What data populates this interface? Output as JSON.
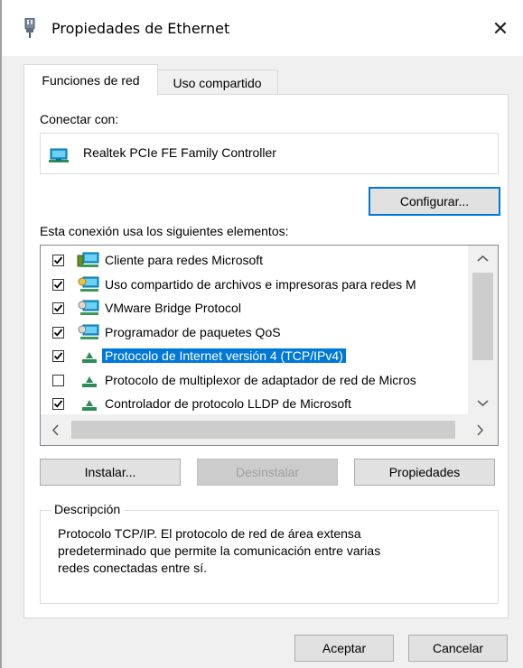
{
  "window": {
    "title": "Propiedades de Ethernet",
    "close_glyph": "✕"
  },
  "tabs": [
    {
      "label": "Funciones de red",
      "active": true
    },
    {
      "label": "Uso compartido",
      "active": false
    }
  ],
  "connect": {
    "label": "Conectar con:",
    "adapter_name": "Realtek PCIe FE Family Controller",
    "configure_label": "Configurar..."
  },
  "elements": {
    "label": "Esta conexión usa los siguientes elementos:",
    "items": [
      {
        "label": "Cliente para redes Microsoft",
        "checked": true,
        "icon": "network-client-icon",
        "selected": false
      },
      {
        "label": "Uso compartido de archivos e impresoras para redes M",
        "checked": true,
        "icon": "file-printer-sharing-icon",
        "selected": false
      },
      {
        "label": "VMware Bridge Protocol",
        "checked": true,
        "icon": "network-service-icon",
        "selected": false
      },
      {
        "label": "Programador de paquetes QoS",
        "checked": true,
        "icon": "network-service-icon",
        "selected": false
      },
      {
        "label": "Protocolo de Internet versión 4 (TCP/IPv4)",
        "checked": true,
        "icon": "protocol-icon",
        "selected": true
      },
      {
        "label": "Protocolo de multiplexor de adaptador de red de Micros",
        "checked": false,
        "icon": "protocol-icon",
        "selected": false
      },
      {
        "label": "Controlador de protocolo LLDP de Microsoft",
        "checked": true,
        "icon": "protocol-icon",
        "selected": false
      }
    ]
  },
  "buttons": {
    "install": "Instalar...",
    "uninstall": "Desinstalar",
    "properties": "Propiedades",
    "ok": "Aceptar",
    "cancel": "Cancelar"
  },
  "description": {
    "title": "Descripción",
    "lines": [
      "Protocolo TCP/IP. El protocolo de red de área extensa",
      "predeterminado que permite la comunicación entre varias",
      "redes conectadas entre sí."
    ]
  },
  "colors": {
    "accent": "#0078d7",
    "selection": "#0078d7",
    "dialog_bg": "#f0f0f0"
  }
}
